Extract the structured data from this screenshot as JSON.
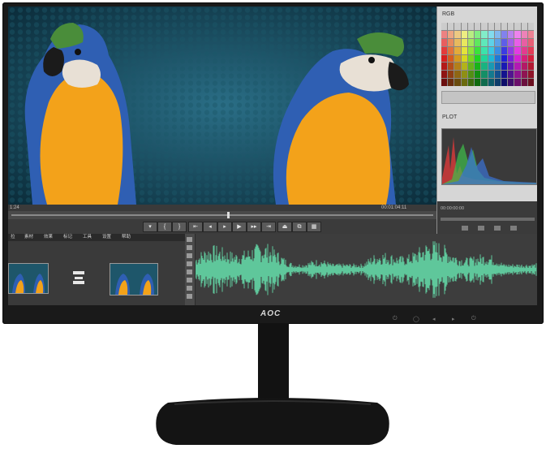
{
  "brand": {
    "logo": "AOC"
  },
  "video": {
    "timecode_left": "1:24",
    "timecode_right": "00:01:04:11",
    "marker": "00:00:00:00"
  },
  "side_panel": {
    "rgb_label": "RGB",
    "plot_label": "PLOT",
    "transport_timecode": "00:00:00:00"
  },
  "toolbar": {
    "buttons": [
      "▾",
      "{",
      "}",
      "⇤",
      "◂",
      "▸",
      "▶",
      "▸▸",
      "⇥",
      "⏏",
      "⧉",
      "▦"
    ]
  },
  "bottom_menu": {
    "items": [
      "拉",
      "素材",
      "效果",
      "标记",
      "工具",
      "设置",
      "帮助"
    ]
  },
  "colors": {
    "bezel": "#1a1a1a",
    "waveform": "#5fc79b",
    "video_bg": "#123a4a",
    "parrot_blue": "#2f5fb3",
    "parrot_yellow": "#f3a21a"
  },
  "hardware_buttons": [
    "⏻",
    "◯",
    "◂",
    "▸",
    "◉",
    "⏻"
  ]
}
